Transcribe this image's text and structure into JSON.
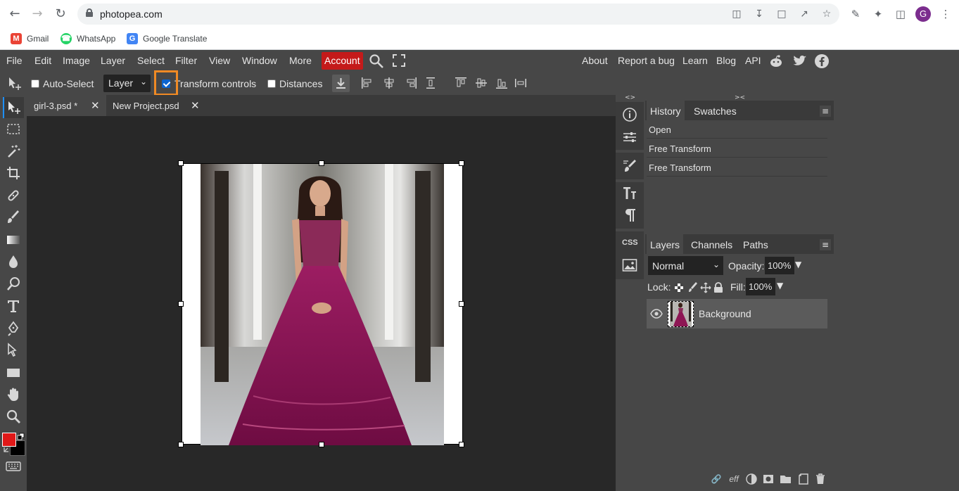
{
  "browser": {
    "url": "photopea.com",
    "avatar_letter": "G",
    "bookmarks": [
      {
        "label": "Gmail",
        "icon": "gmail-icon",
        "color": "#ea4335"
      },
      {
        "label": "WhatsApp",
        "icon": "whatsapp-icon",
        "color": "#25d366"
      },
      {
        "label": "Google Translate",
        "icon": "google-translate-icon",
        "color": "#4285f4"
      }
    ]
  },
  "menubar": {
    "items": [
      "File",
      "Edit",
      "Image",
      "Layer",
      "Select",
      "Filter",
      "View",
      "Window",
      "More"
    ],
    "account": "Account",
    "right_links": [
      "About",
      "Report a bug",
      "Learn",
      "Blog",
      "API"
    ],
    "account_color": "#c41a1a"
  },
  "options": {
    "auto_select_label": "Auto-Select",
    "auto_select_checked": false,
    "layer_select_value": "Layer",
    "transform_controls_label": "Transform controls",
    "transform_controls_checked": true,
    "distances_label": "Distances",
    "distances_checked": false
  },
  "documents": {
    "tabs": [
      {
        "label": "girl-3.psd *",
        "active": true
      },
      {
        "label": "New Project.psd",
        "active": false
      }
    ]
  },
  "colors": {
    "foreground": "#e01818",
    "background": "#000000"
  },
  "history": {
    "tabs": [
      "History",
      "Swatches"
    ],
    "rows": [
      "Open",
      "Free Transform",
      "Free Transform"
    ]
  },
  "layers": {
    "tabs": [
      "Layers",
      "Channels",
      "Paths"
    ],
    "blend_mode": "Normal",
    "opacity_label": "Opacity:",
    "opacity_value": "100%",
    "lock_label": "Lock:",
    "fill_label": "Fill:",
    "fill_value": "100%",
    "items": [
      {
        "name": "Background",
        "visible": true
      }
    ]
  }
}
